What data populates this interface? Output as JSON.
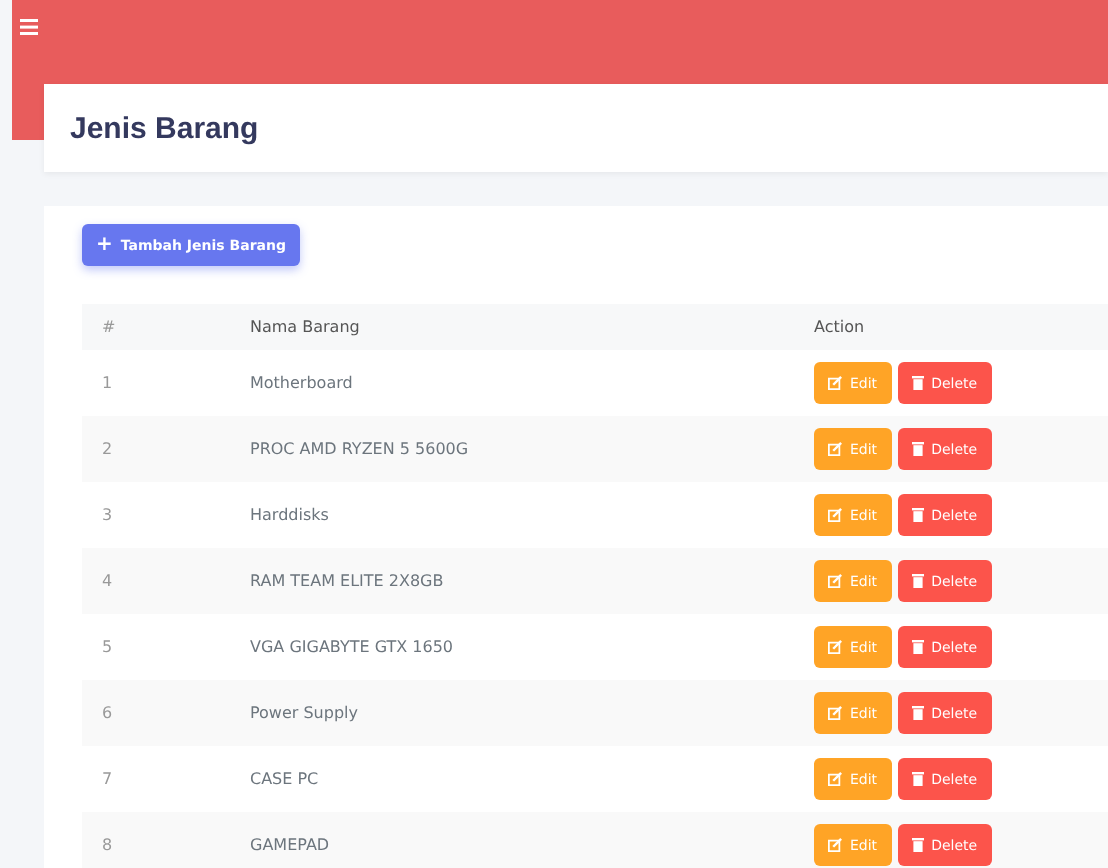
{
  "page_title": "Jenis Barang",
  "add_button": {
    "icon": "+",
    "label": "Tambah Jenis Barang"
  },
  "table": {
    "columns": [
      "#",
      "Nama Barang",
      "Action"
    ],
    "rows": [
      {
        "no": "1",
        "name": "Motherboard",
        "edit": "Edit",
        "delete": "Delete"
      },
      {
        "no": "2",
        "name": "PROC AMD RYZEN 5 5600G",
        "edit": "Edit",
        "delete": "Delete"
      },
      {
        "no": "3",
        "name": "Harddisks",
        "edit": "Edit",
        "delete": "Delete"
      },
      {
        "no": "4",
        "name": "RAM TEAM ELITE 2X8GB",
        "edit": "Edit",
        "delete": "Delete"
      },
      {
        "no": "5",
        "name": "VGA GIGABYTE GTX 1650",
        "edit": "Edit",
        "delete": "Delete"
      },
      {
        "no": "6",
        "name": "Power Supply",
        "edit": "Edit",
        "delete": "Delete"
      },
      {
        "no": "7",
        "name": "CASE PC",
        "edit": "Edit",
        "delete": "Delete"
      },
      {
        "no": "8",
        "name": "GAMEPAD",
        "edit": "Edit",
        "delete": "Delete"
      }
    ]
  }
}
